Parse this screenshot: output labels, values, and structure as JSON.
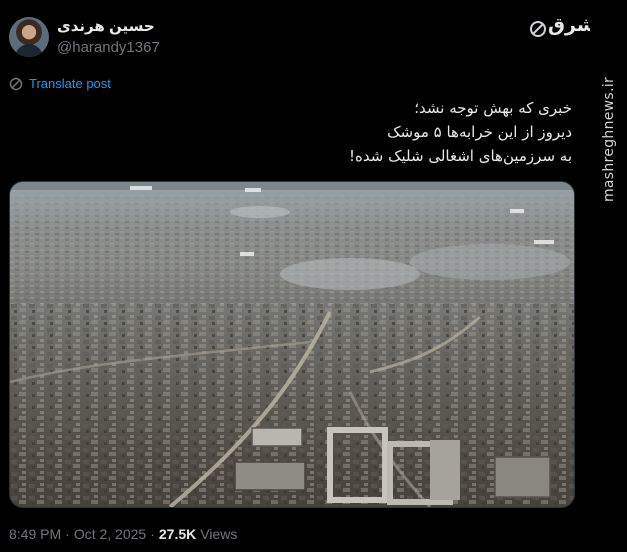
{
  "author": {
    "display_name": "حسین هرندی",
    "handle": "@harandy1367"
  },
  "brand": {
    "logo_text": "مشرق",
    "watermark": "mashreghnews.ir",
    "icon": "mashregh-logo-icon"
  },
  "translate": {
    "label": "Translate post",
    "icon": "translate-globe-icon",
    "color": "#1d9bf0"
  },
  "tweet": {
    "lines": [
      "خبری که بهش توجه نشد؛",
      "دیروز از این خرابه‌ها ۵ موشک",
      "به سرزمین‌های اشغالی شلیک شده!"
    ]
  },
  "media": {
    "description_icon": "aerial-photo-image"
  },
  "meta": {
    "time": "8:49 PM",
    "separator": "·",
    "date": "Oct 2, 2025",
    "views_count": "27.5K",
    "views_label": "Views"
  },
  "colors": {
    "background": "#000000",
    "text_primary": "#e7e9ea",
    "text_secondary": "#71767b",
    "link": "#1d9bf0"
  }
}
